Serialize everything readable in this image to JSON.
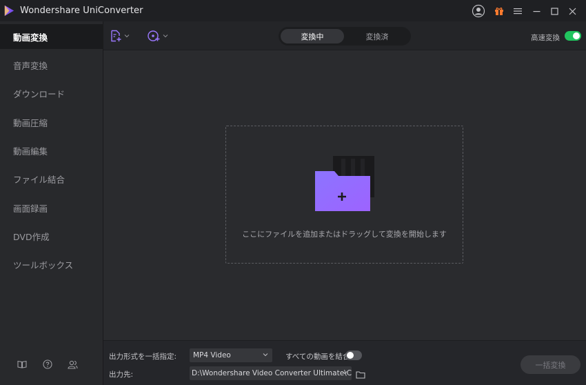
{
  "app": {
    "title": "Wondershare UniConverter"
  },
  "titlebar_icons": [
    "user-account-icon",
    "gift-icon",
    "menu-icon",
    "minimize-icon",
    "maximize-icon",
    "close-icon"
  ],
  "sidebar": {
    "items": [
      {
        "label": "動画変換",
        "active": true
      },
      {
        "label": "音声変換",
        "active": false
      },
      {
        "label": "ダウンロード",
        "active": false
      },
      {
        "label": "動画圧縮",
        "active": false
      },
      {
        "label": "動画編集",
        "active": false
      },
      {
        "label": "ファイル結合",
        "active": false
      },
      {
        "label": "画面録画",
        "active": false
      },
      {
        "label": "DVD作成",
        "active": false
      },
      {
        "label": "ツールボックス",
        "active": false
      }
    ],
    "bottom_icons": [
      "book-icon",
      "help-icon",
      "users-icon"
    ]
  },
  "toolbar": {
    "tabs": {
      "active": "変換中",
      "inactive": "変換済"
    },
    "fast_convert_label": "高速変換",
    "fast_convert_on": true
  },
  "dropzone": {
    "text": "ここにファイルを追加またはドラッグして変換を開始します"
  },
  "bottom": {
    "format_label": "出力形式を一括指定:",
    "format_value": "MP4 Video",
    "merge_label": "すべての動画を結合",
    "merge_on": false,
    "output_label": "出力先:",
    "output_path": "D:\\Wondershare Video Converter Ultimate\\Co",
    "convert_all_label": "一括変換"
  },
  "colors": {
    "accent_green": "#21c45e",
    "folder_purple": "#8f6bff",
    "background": "#2a2b2e"
  }
}
